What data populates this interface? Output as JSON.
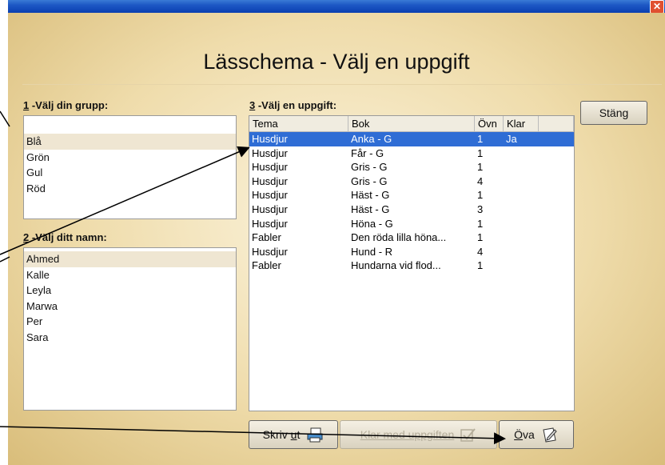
{
  "window": {
    "title": "Lässchema - Välj en uppgift",
    "close_glyph": "✕"
  },
  "group": {
    "num": "1",
    "label": " -Välj din grupp:",
    "items": [
      "Blå",
      "Grön",
      "Gul",
      "Röd"
    ],
    "selected": "Blå"
  },
  "name": {
    "num": "2",
    "label": " -Välj ditt namn:",
    "items": [
      "Ahmed",
      "Kalle",
      "Leyla",
      "Marwa",
      "Per",
      "Sara"
    ],
    "selected": "Ahmed"
  },
  "task": {
    "num": "3",
    "label": " -Välj en uppgift:",
    "columns": [
      "Tema",
      "Bok",
      "Övn",
      "Klar"
    ],
    "rows": [
      [
        "Husdjur",
        "Anka - G",
        "1",
        "Ja"
      ],
      [
        "Husdjur",
        "Får - G",
        "1",
        ""
      ],
      [
        "Husdjur",
        "Gris - G",
        "1",
        ""
      ],
      [
        "Husdjur",
        "Gris - G",
        "4",
        ""
      ],
      [
        "Husdjur",
        "Häst - G",
        "1",
        ""
      ],
      [
        "Husdjur",
        "Häst - G",
        "3",
        ""
      ],
      [
        "Husdjur",
        "Höna - G",
        "1",
        ""
      ],
      [
        "Fabler",
        "Den röda lilla höna...",
        "1",
        ""
      ],
      [
        "Husdjur",
        "Hund - R",
        "4",
        ""
      ],
      [
        "Fabler",
        "Hundarna vid flod...",
        "1",
        ""
      ]
    ],
    "selected_row": 0
  },
  "buttons": {
    "close": "Stäng",
    "print_pre": "Skriv ",
    "print_key": "u",
    "print_post": "t",
    "done": "Klar med uppgiften",
    "practice_key": "Ö",
    "practice_post": "va"
  },
  "colors": {
    "selection": "#2f6dd5",
    "title_bar": "#1d57c4"
  }
}
